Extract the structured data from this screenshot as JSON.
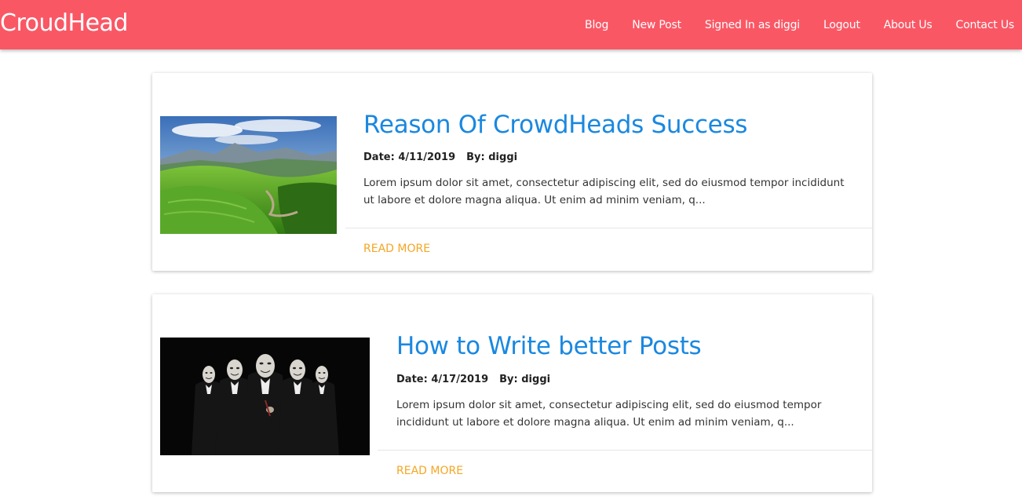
{
  "brand": "CroudHead",
  "nav": {
    "items": [
      "Blog",
      "New Post",
      "Signed In as diggi",
      "Logout",
      "About Us",
      "Contact Us"
    ]
  },
  "posts": [
    {
      "title": "Reason Of CrowdHeads Success",
      "date": "Date: 4/11/2019",
      "author": "By: diggi",
      "excerpt": "Lorem ipsum dolor sit amet, consectetur adipiscing elit, sed do eiusmod tempor incididunt ut labore et dolore magna aliqua. Ut enim ad minim veniam, q...",
      "read_more": "READ MORE",
      "image": "green-tea-hills-landscape"
    },
    {
      "title": "How to Write better Posts",
      "date": "Date: 4/17/2019",
      "author": "By: diggi",
      "excerpt": "Lorem ipsum dolor sit amet, consectetur adipiscing elit, sed do eiusmod tempor incididunt ut labore et dolore magna aliqua. Ut enim ad minim veniam, q...",
      "read_more": "READ MORE",
      "image": "masked-figures-in-suits"
    }
  ],
  "colors": {
    "navbar": "#fa5765",
    "title": "#1a88e0",
    "read_more": "#f5a623"
  }
}
